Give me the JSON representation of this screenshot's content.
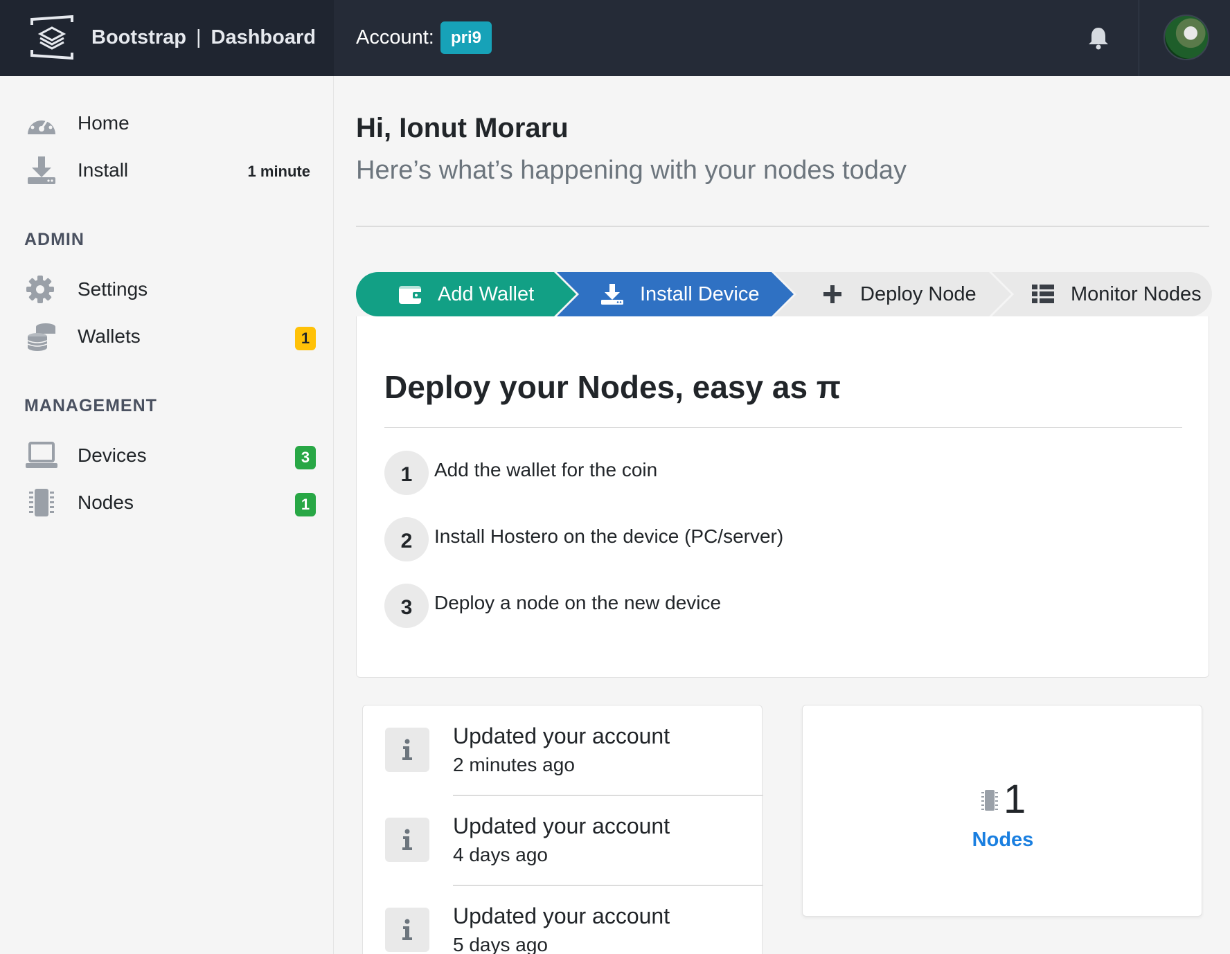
{
  "header": {
    "brand_name": "Bootstrap",
    "brand_separator": "|",
    "brand_section": "Dashboard",
    "account_label": "Account:",
    "account_id": "pri9"
  },
  "sidebar": {
    "items": [
      {
        "label": "Home",
        "icon": "dashboard-gauge-icon"
      },
      {
        "label": "Install",
        "icon": "download-icon",
        "meta": "1 minute"
      }
    ],
    "admin_heading": "ADMIN",
    "admin_items": [
      {
        "label": "Settings",
        "icon": "gear-icon"
      },
      {
        "label": "Wallets",
        "icon": "coins-icon",
        "badge": "1"
      }
    ],
    "management_heading": "MANAGEMENT",
    "management_items": [
      {
        "label": "Devices",
        "icon": "laptop-icon",
        "badge": "3"
      },
      {
        "label": "Nodes",
        "icon": "chip-icon",
        "badge": "1"
      }
    ]
  },
  "main": {
    "greeting": "Hi, Ionut Moraru",
    "subgreeting": "Here’s what’s happening with your nodes today",
    "steps": [
      {
        "label": "Add Wallet",
        "icon": "wallet-icon",
        "state": "done"
      },
      {
        "label": "Install Device",
        "icon": "download-icon",
        "state": "active"
      },
      {
        "label": "Deploy Node",
        "icon": "plus-icon",
        "state": "pending"
      },
      {
        "label": "Monitor Nodes",
        "icon": "list-icon",
        "state": "pending"
      }
    ],
    "card_title": "Deploy your Nodes, easy as π",
    "instructions": [
      {
        "num": "1",
        "text": "Add the wallet for the coin"
      },
      {
        "num": "2",
        "text": "Install Hostero on the device (PC/server)"
      },
      {
        "num": "3",
        "text": "Deploy a node on the new device"
      }
    ],
    "activity": [
      {
        "title": "Updated your account",
        "time": "2 minutes ago"
      },
      {
        "title": "Updated your account",
        "time": "4 days ago"
      },
      {
        "title": "Updated your account",
        "time": "5 days ago"
      }
    ],
    "stat": {
      "value": "1",
      "label": "Nodes"
    }
  },
  "colors": {
    "topbar": "#252b37",
    "step_done": "#12a085",
    "step_active": "#2f71c3",
    "account_badge": "#17a2b8",
    "link": "#1a7fe0"
  }
}
